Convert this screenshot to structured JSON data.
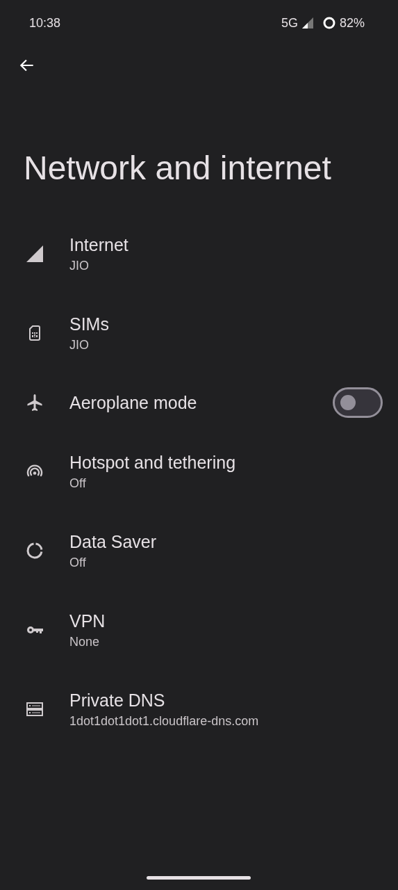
{
  "status_bar": {
    "time": "10:38",
    "network": "5G",
    "battery": "82%"
  },
  "title": "Network and internet",
  "items": [
    {
      "kind": "signal",
      "title": "Internet",
      "subtitle": "JIO"
    },
    {
      "kind": "sim",
      "title": "SIMs",
      "subtitle": "JIO"
    },
    {
      "kind": "plane",
      "title": "Aeroplane mode",
      "on": false
    },
    {
      "kind": "hotspot",
      "title": "Hotspot and tethering",
      "subtitle": "Off"
    },
    {
      "kind": "datasaver",
      "title": "Data Saver",
      "subtitle": "Off"
    },
    {
      "kind": "key",
      "title": "VPN",
      "subtitle": "None"
    },
    {
      "kind": "dns",
      "title": "Private DNS",
      "subtitle": "1dot1dot1dot1.cloudflare-dns.com"
    }
  ]
}
